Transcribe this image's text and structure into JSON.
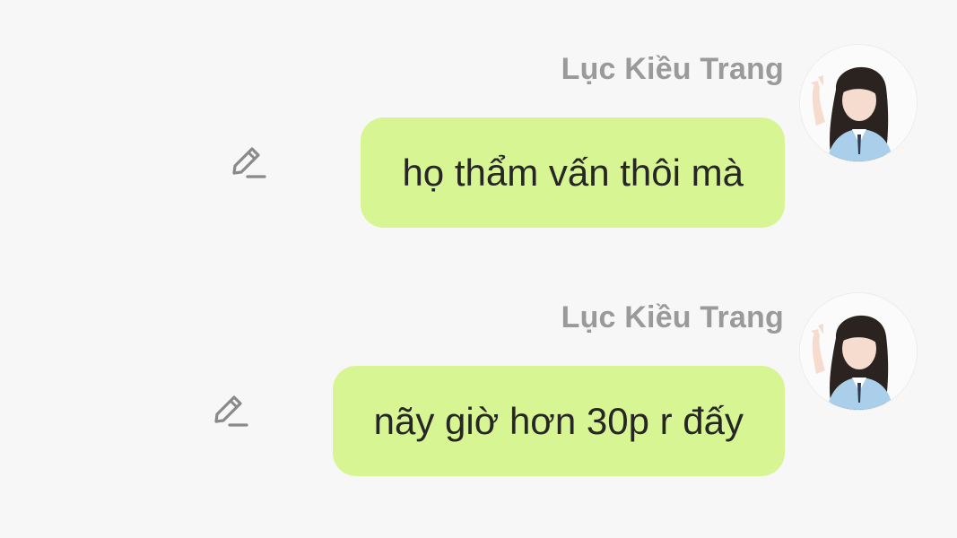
{
  "messages": [
    {
      "sender": "Lục Kiều Trang",
      "text": "họ thẩm vấn thôi mà",
      "avatar_icon": "user-avatar-photo",
      "action_icon": "pencil-edit-icon"
    },
    {
      "sender": "Lục Kiều Trang",
      "text": "nãy giờ hơn 30p r đấy",
      "avatar_icon": "user-avatar-photo",
      "action_icon": "pencil-edit-icon"
    }
  ],
  "colors": {
    "background": "#f7f7f7",
    "bubble": "#d8f594",
    "sender_text": "#9a9a9a",
    "message_text": "#262626",
    "icon": "#8a8a8a"
  }
}
